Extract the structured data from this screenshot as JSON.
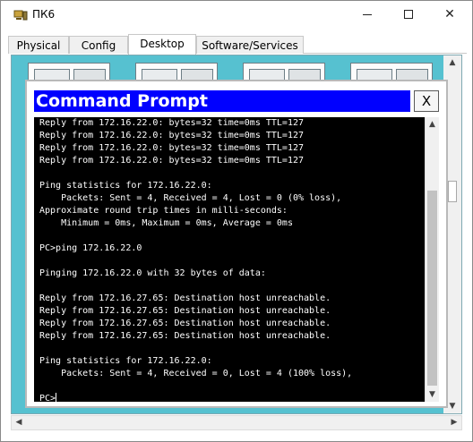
{
  "window": {
    "title": "ПК6",
    "minimize_glyph": "",
    "maximize_glyph": "",
    "close_glyph": "✕"
  },
  "tabs": [
    {
      "label": "Physical"
    },
    {
      "label": "Config"
    },
    {
      "label": "Desktop"
    },
    {
      "label": "Software/Services"
    }
  ],
  "active_tab": "Desktop",
  "command_prompt": {
    "title": "Command Prompt",
    "close_label": "X",
    "lines": [
      "Reply from 172.16.22.0: bytes=32 time=0ms TTL=127",
      "Reply from 172.16.22.0: bytes=32 time=0ms TTL=127",
      "Reply from 172.16.22.0: bytes=32 time=0ms TTL=127",
      "Reply from 172.16.22.0: bytes=32 time=0ms TTL=127",
      "",
      "Ping statistics for 172.16.22.0:",
      "    Packets: Sent = 4, Received = 4, Lost = 0 (0% loss),",
      "Approximate round trip times in milli-seconds:",
      "    Minimum = 0ms, Maximum = 0ms, Average = 0ms",
      "",
      "PC>ping 172.16.22.0",
      "",
      "Pinging 172.16.22.0 with 32 bytes of data:",
      "",
      "Reply from 172.16.27.65: Destination host unreachable.",
      "Reply from 172.16.27.65: Destination host unreachable.",
      "Reply from 172.16.27.65: Destination host unreachable.",
      "Reply from 172.16.27.65: Destination host unreachable.",
      "",
      "Ping statistics for 172.16.22.0:",
      "    Packets: Sent = 4, Received = 0, Lost = 4 (100% loss),",
      "",
      "PC>"
    ]
  },
  "colors": {
    "desktop_background": "#56c1d0",
    "prompt_titlebar": "#0000ff",
    "console_background": "#000000",
    "console_text": "#ffffff"
  },
  "icons": {
    "app": "packet-tracer-pc-icon",
    "scroll_up": "chevron-up-icon",
    "scroll_down": "chevron-down-icon",
    "scroll_left": "chevron-left-icon",
    "scroll_right": "chevron-right-icon"
  }
}
